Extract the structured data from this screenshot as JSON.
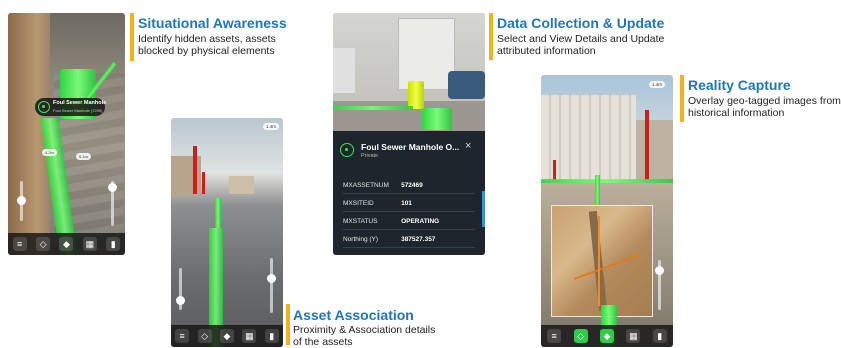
{
  "sections": {
    "situational": {
      "title": "Situational Awareness",
      "desc_line1": "Identify hidden assets, assets",
      "desc_line2": "blocked by physical elements"
    },
    "data_collection": {
      "title": "Data Collection & Update",
      "desc_line1": "Select and View Details and Update",
      "desc_line2": "attributed information"
    },
    "reality": {
      "title": "Reality Capture",
      "desc_line1": "Overlay geo-tagged images from",
      "desc_line2": "historical information"
    },
    "asset_association": {
      "title": "Asset Association",
      "desc_line1": "Proximity & Association details",
      "desc_line2": "of the assets"
    }
  },
  "phone1": {
    "popup_title": "Foul Sewer Manhole",
    "popup_subtitle": "Foul Sewer Manhole (7259)",
    "icons": [
      "menu-icon",
      "layers-icon",
      "compass-icon",
      "grid-icon",
      "map-icon"
    ]
  },
  "phone3": {
    "card_title": "Foul Sewer Manhole O...",
    "card_subtitle": "Private",
    "close_glyph": "×",
    "rows": [
      {
        "key": "MXASSETNUM",
        "value": "572469"
      },
      {
        "key": "MXSITEID",
        "value": "101"
      },
      {
        "key": "MXSTATUS",
        "value": "OPERATING"
      },
      {
        "key": "Northing (Y)",
        "value": "387527.357"
      }
    ]
  },
  "colors": {
    "callout_bar": "#f2b21a",
    "title_blue": "#1f76b8",
    "pipe_green": "#34d94a",
    "pole_red": "#c91f1f",
    "card_dark": "#1e252c"
  }
}
